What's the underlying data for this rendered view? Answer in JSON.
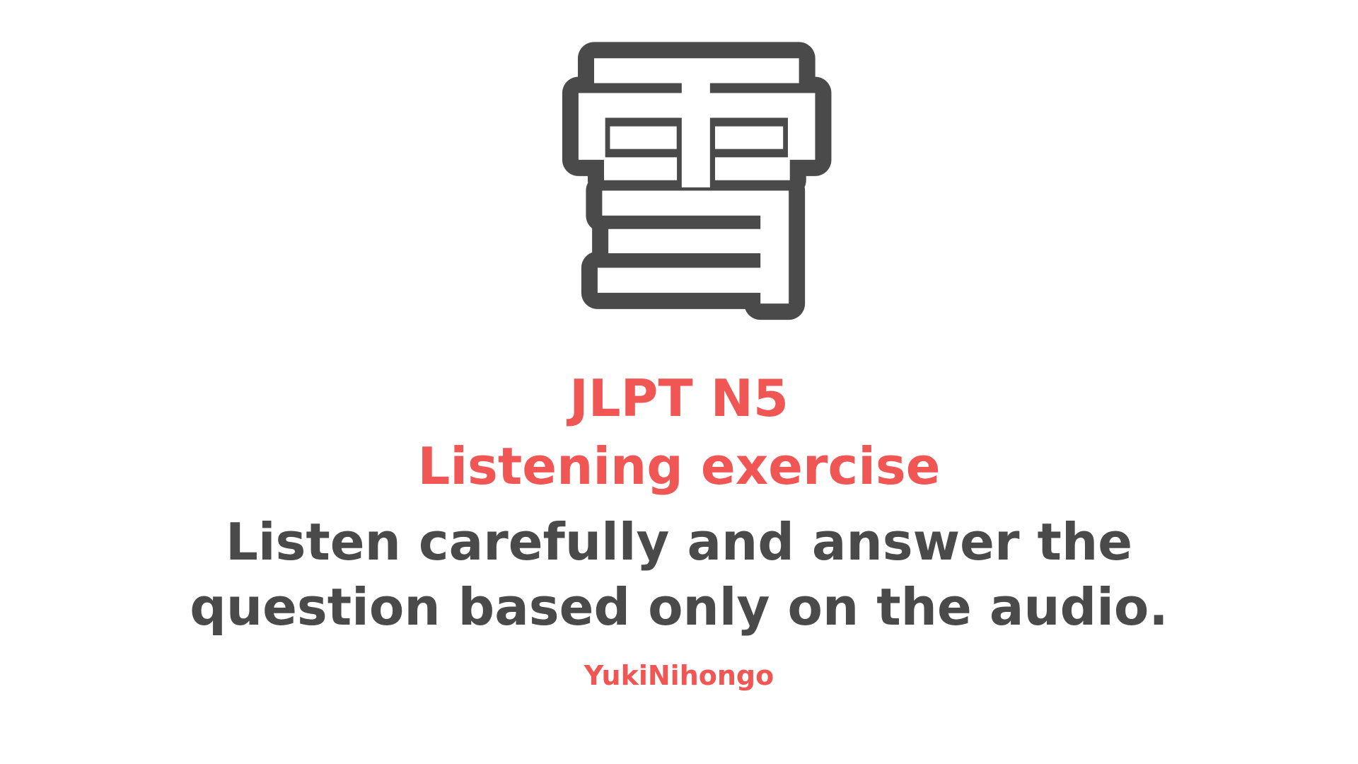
{
  "logo": {
    "glyph": "雪",
    "fill_color": "#ffffff",
    "outline_color": "#4a4a4a"
  },
  "heading": {
    "title": "JLPT N5",
    "subtitle": "Listening exercise"
  },
  "instructions": {
    "line1": "Listen carefully and answer the",
    "line2": "question based only on the audio."
  },
  "brand": {
    "name": "YukiNihongo"
  },
  "colors": {
    "accent": "#f05654",
    "text_dark": "#4a4a4a",
    "background": "#ffffff"
  }
}
